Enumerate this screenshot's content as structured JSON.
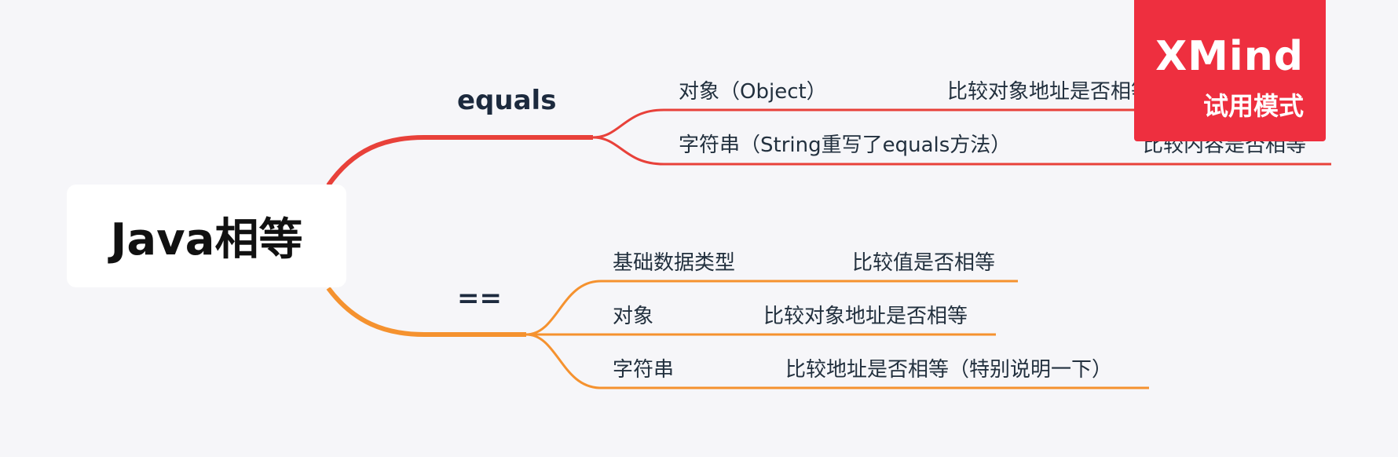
{
  "mindmap": {
    "root": "Java相等",
    "branches": [
      {
        "label": "equals",
        "color": "#e8413a",
        "children": [
          {
            "label": "对象（Object）",
            "note": "比较对象地址是否相等"
          },
          {
            "label": "字符串（String重写了equals方法）",
            "note": "比较内容是否相等"
          }
        ]
      },
      {
        "label": "==",
        "color": "#f5922f",
        "children": [
          {
            "label": "基础数据类型",
            "note": "比较值是否相等"
          },
          {
            "label": "对象",
            "note": "比较对象地址是否相等"
          },
          {
            "label": "字符串",
            "note": "比较地址是否相等（特别说明一下）"
          }
        ]
      }
    ]
  },
  "watermark": {
    "title": "XMind",
    "subtitle": "试用模式",
    "color": "#ee2f3f"
  }
}
